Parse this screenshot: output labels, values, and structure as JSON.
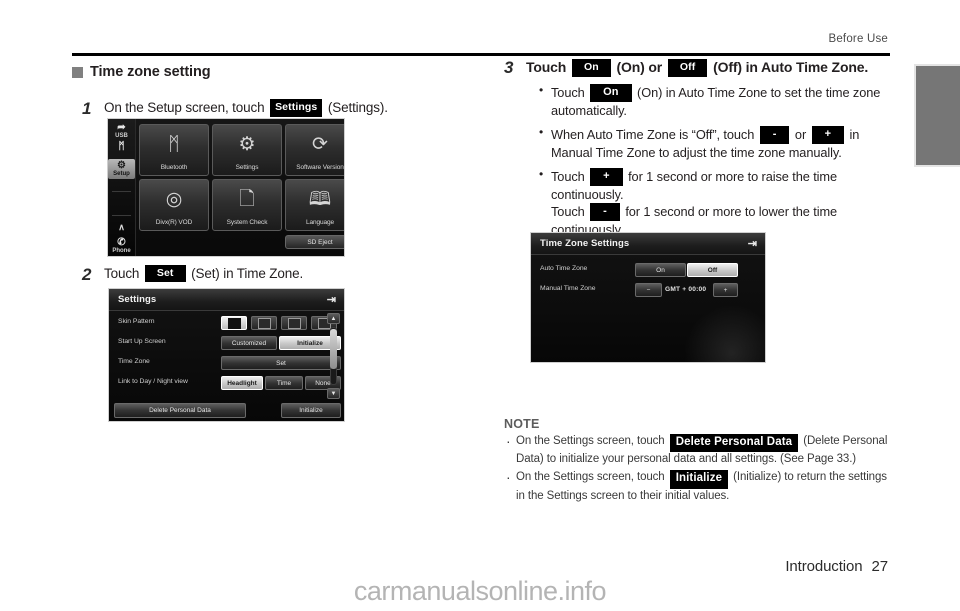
{
  "header": {
    "running_head": "Before Use"
  },
  "footer": {
    "section": "Introduction",
    "page_number": "27",
    "watermark": "carmanualsonline.info"
  },
  "left_column": {
    "section_heading": "Time zone setting",
    "step1": {
      "number": "1",
      "text_before": "On the Setup screen, touch",
      "key": "Settings",
      "text_after": "(Settings)."
    },
    "step2": {
      "number": "2",
      "text_before": "Touch",
      "key": "Set",
      "text_after": "(Set) in Time Zone."
    }
  },
  "right_column": {
    "step3": {
      "number": "3",
      "text_before": "Touch",
      "key_on": "On",
      "text_mid1": "(On) or",
      "key_off": "Off",
      "text_after": "(Off) in Auto Time Zone."
    },
    "bullets": [
      {
        "parts": [
          {
            "t": "text",
            "v": "Touch "
          },
          {
            "t": "key",
            "v": "On"
          },
          {
            "t": "text",
            "v": " (On) in Auto Time Zone to set the time zone automatically."
          }
        ]
      },
      {
        "parts": [
          {
            "t": "text",
            "v": "When Auto Time Zone is “Off”, touch "
          },
          {
            "t": "key",
            "v": "-"
          },
          {
            "t": "text",
            "v": " or "
          },
          {
            "t": "key",
            "v": "+"
          },
          {
            "t": "text",
            "v": " in Manual Time Zone to adjust the time zone manually."
          }
        ]
      },
      {
        "parts": [
          {
            "t": "text",
            "v": "Touch "
          },
          {
            "t": "key",
            "v": "+"
          },
          {
            "t": "text",
            "v": " for 1 second or more to raise the time continuously."
          },
          {
            "t": "br",
            "v": ""
          },
          {
            "t": "text",
            "v": "Touch "
          },
          {
            "t": "key",
            "v": "-"
          },
          {
            "t": "text",
            "v": " for 1 second or more to lower the time continuously."
          }
        ]
      }
    ],
    "note": {
      "title": "NOTE",
      "items": [
        {
          "parts": [
            {
              "t": "text",
              "v": "On the Settings screen, touch "
            },
            {
              "t": "key",
              "v": "Delete Personal Data"
            },
            {
              "t": "text",
              "v": " (Delete Personal Data) to initialize your personal data and all settings. (See Page 33.)"
            }
          ]
        },
        {
          "parts": [
            {
              "t": "text",
              "v": "On the Settings screen, touch "
            },
            {
              "t": "key",
              "v": "Initialize"
            },
            {
              "t": "text",
              "v": " (Initialize) to return the settings in the Settings screen to their initial values."
            }
          ]
        }
      ]
    }
  },
  "device_setup_screen": {
    "sidebar": [
      {
        "label": "USB",
        "icon": "usb-icon",
        "glyph": "⮛",
        "selected": false
      },
      {
        "label": "",
        "icon": "bluetooth-icon",
        "glyph": "ᛗ",
        "selected": false
      },
      {
        "label": "Setup",
        "icon": "setup-gear-icon",
        "glyph": "⚙",
        "selected": true
      },
      {
        "label": "",
        "icon": "up-arrow-icon",
        "glyph": "∧",
        "selected": false
      },
      {
        "label": "Phone",
        "icon": "phone-icon",
        "glyph": "✆",
        "selected": false
      }
    ],
    "tiles": [
      {
        "label": "Bluetooth",
        "icon": "bluetooth-icon",
        "glyph": "ᛗ"
      },
      {
        "label": "Settings",
        "icon": "settings-gear-wrench-icon",
        "glyph": "⚙"
      },
      {
        "label": "Software Version",
        "icon": "refresh-circular-arrow-icon",
        "glyph": "⟳"
      },
      {
        "label": "Divx(R) VOD",
        "icon": "disc-icon",
        "glyph": "◎"
      },
      {
        "label": "System Check",
        "icon": "checklist-clipboard-icon",
        "glyph": "Ὕ2"
      },
      {
        "label": "Language",
        "icon": "open-book-icon",
        "glyph": "ὖe"
      }
    ],
    "sd_eject_label": "SD Eject"
  },
  "device_settings_screen": {
    "title": "Settings",
    "back_icon": "back-arrow-icon",
    "rows": [
      {
        "label": "Skin Pattern",
        "type": "swatches",
        "options": [
          {
            "label": "",
            "selected": true
          },
          {
            "label": "",
            "selected": false
          },
          {
            "label": "",
            "selected": false
          },
          {
            "label": "",
            "selected": false
          }
        ]
      },
      {
        "label": "Start Up Screen",
        "type": "buttons",
        "options": [
          {
            "label": "Customized",
            "selected": false
          },
          {
            "label": "Initialize",
            "selected": true
          }
        ]
      },
      {
        "label": "Time Zone",
        "type": "buttons",
        "options": [
          {
            "label": "Set",
            "selected": false
          }
        ]
      },
      {
        "label": "Link to Day / Night view",
        "type": "buttons",
        "options": [
          {
            "label": "Headlight",
            "selected": true
          },
          {
            "label": "Time",
            "selected": false
          },
          {
            "label": "None",
            "selected": false
          }
        ]
      }
    ],
    "bottom_buttons": [
      {
        "label": "Delete Personal Data"
      },
      {
        "label": "Initialize"
      }
    ],
    "scroll_up_icon": "scroll-up-arrow-icon",
    "scroll_down_icon": "scroll-down-arrow-icon"
  },
  "device_timezone_screen": {
    "title": "Time Zone Settings",
    "back_icon": "back-arrow-icon",
    "auto_row": {
      "label": "Auto Time Zone",
      "options": [
        {
          "label": "On",
          "selected": false
        },
        {
          "label": "Off",
          "selected": true
        }
      ]
    },
    "manual_row": {
      "label": "Manual Time Zone",
      "minus": "−",
      "value": "GMT  +  00:00",
      "plus": "+"
    }
  }
}
